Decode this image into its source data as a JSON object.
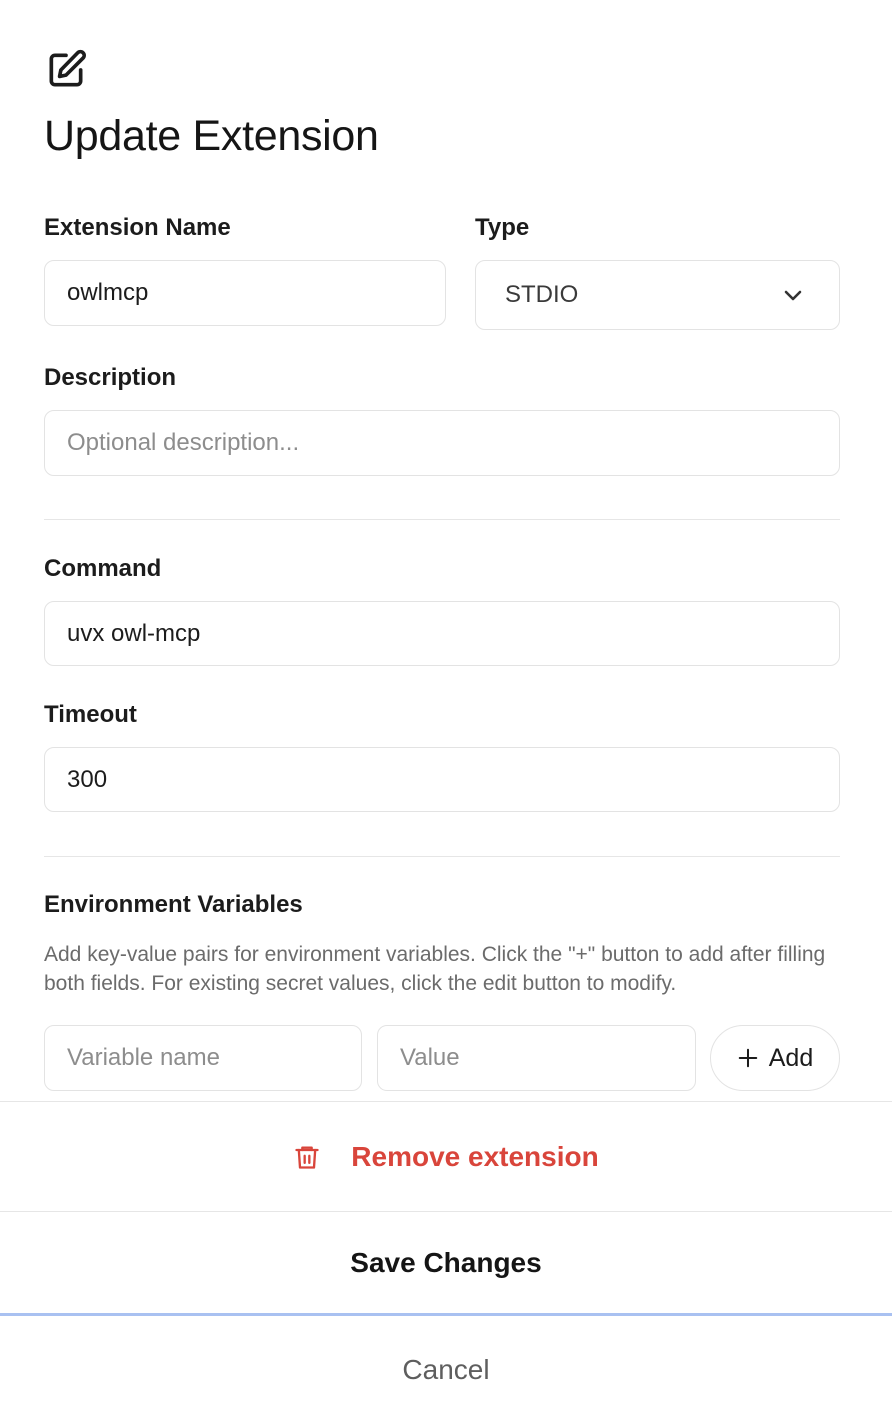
{
  "dialog": {
    "title": "Update Extension",
    "icon": "edit-icon"
  },
  "form": {
    "name_label": "Extension Name",
    "name_value": "owlmcp",
    "type_label": "Type",
    "type_value": "STDIO",
    "description_label": "Description",
    "description_placeholder": "Optional description...",
    "command_label": "Command",
    "command_value": "uvx owl-mcp",
    "timeout_label": "Timeout",
    "timeout_value": "300"
  },
  "env": {
    "heading": "Environment Variables",
    "help": "Add key-value pairs for environment variables. Click the \"+\" button to add after filling both fields. For existing secret values, click the edit button to modify.",
    "name_placeholder": "Variable name",
    "value_placeholder": "Value",
    "add_label": "Add"
  },
  "actions": {
    "remove_label": "Remove extension",
    "save_label": "Save Changes",
    "cancel_label": "Cancel"
  },
  "colors": {
    "danger": "#d9453b",
    "focus": "#a9c1f1",
    "border": "#e3e3e3"
  }
}
